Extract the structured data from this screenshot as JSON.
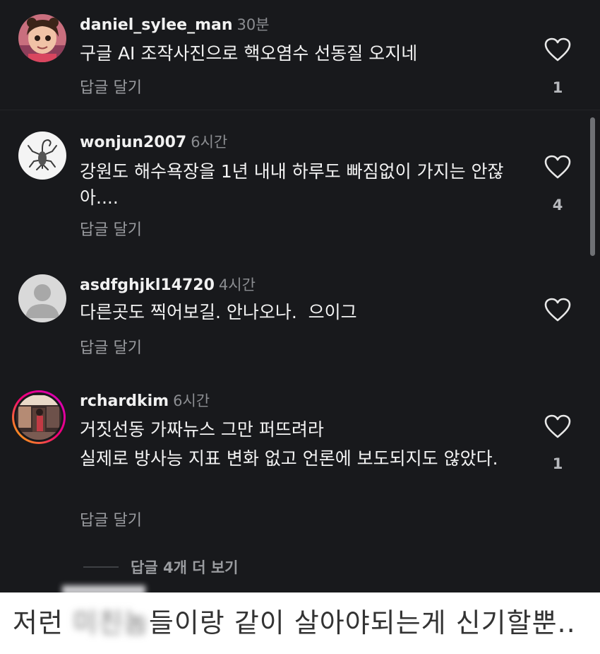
{
  "comments": [
    {
      "username": "daniel_sylee_man",
      "time": "30분",
      "text": "구글 AI 조작사진으로 핵오염수 선동질 오지네",
      "reply_label": "답글 달기",
      "likes": "1",
      "avatar": "cartoon-girl-avatar"
    },
    {
      "username": "wonjun2007",
      "time": "6시간",
      "text": "강원도 해수욕장을 1년 내내 하루도 빠짐없이 가지는 안잖아....",
      "reply_label": "답글 달기",
      "likes": "4",
      "avatar": "scorpion-avatar"
    },
    {
      "username": "asdfghjkl14720",
      "time": "4시간",
      "text": "다른곳도 찍어보길. 안나오나.  으이그",
      "reply_label": "답글 달기",
      "likes": "",
      "avatar": "default-user-avatar"
    },
    {
      "username": "rchardkim",
      "time": "6시간",
      "text_line1": "거짓선동 가짜뉴스 그만 퍼뜨려라",
      "text_line2": "실제로 방사능 지표 변화 없고 언론에 보도되지도 않았다.",
      "reply_label": "답글 달기",
      "likes": "1",
      "avatar": "story-ring-photo-avatar"
    }
  ],
  "more_replies_label": "답글 4개 더 보기",
  "caption": {
    "before": "저런 ",
    "blurred": "미친놈",
    "after": "들이랑 같이 살아야되는게 신기할뿐.."
  },
  "colors": {
    "background": "#18191c",
    "username": "#f1f1f1",
    "secondary": "#9a9ca0",
    "story_ring_start": "#fdc400",
    "story_ring_end": "#d300c5"
  }
}
